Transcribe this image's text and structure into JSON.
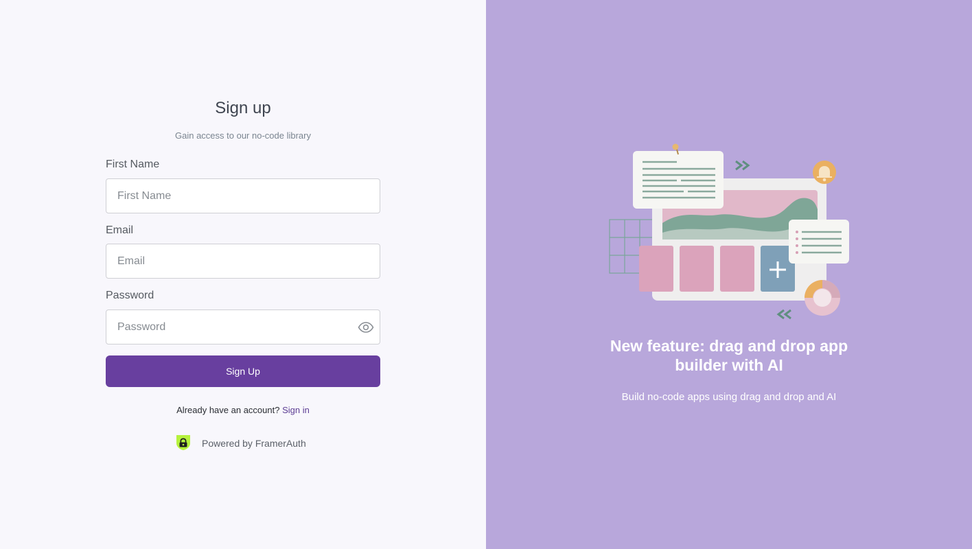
{
  "signup": {
    "title": "Sign up",
    "subtitle": "Gain access to our no-code library",
    "first_name_label": "First Name",
    "first_name_placeholder": "First Name",
    "email_label": "Email",
    "email_placeholder": "Email",
    "password_label": "Password",
    "password_placeholder": "Password",
    "submit_label": "Sign Up",
    "already_text": "Already have an account?",
    "signin_link": "Sign in",
    "powered_by": "Powered by FramerAuth"
  },
  "promo": {
    "headline": "New feature: drag and drop app builder with AI",
    "subline": "Build no-code apps using drag and drop and AI"
  },
  "icons": {
    "password_toggle": "eye-icon",
    "brand_logo": "framerauth-logo-icon"
  },
  "colors": {
    "left_bg": "#f8f7fc",
    "right_bg": "#b8a7db",
    "primary": "#683f9f",
    "link": "#5d3e94",
    "logo_green": "#b6f23d"
  }
}
